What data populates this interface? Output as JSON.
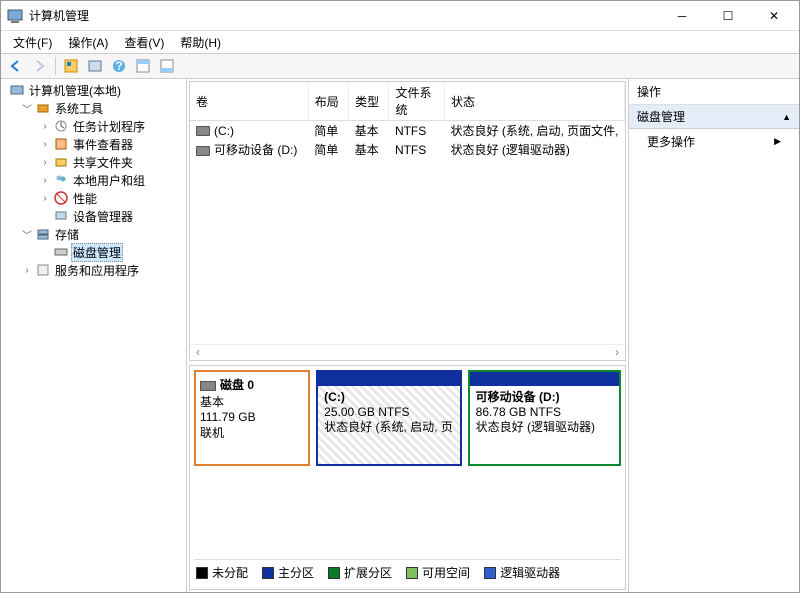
{
  "window": {
    "title": "计算机管理"
  },
  "menu": {
    "file": "文件(F)",
    "action": "操作(A)",
    "view": "查看(V)",
    "help": "帮助(H)"
  },
  "tree": {
    "root": "计算机管理(本地)",
    "systools": "系统工具",
    "scheduler": "任务计划程序",
    "eventviewer": "事件查看器",
    "sharedfolders": "共享文件夹",
    "localusers": "本地用户和组",
    "performance": "性能",
    "devmgr": "设备管理器",
    "storage": "存储",
    "diskmgmt": "磁盘管理",
    "services": "服务和应用程序"
  },
  "volHeaders": {
    "vol": "卷",
    "layout": "布局",
    "type": "类型",
    "fs": "文件系统",
    "status": "状态"
  },
  "volumes": [
    {
      "name": "(C:)",
      "layout": "简单",
      "type": "基本",
      "fs": "NTFS",
      "status": "状态良好 (系统, 启动, 页面文件,"
    },
    {
      "name": "可移动设备 (D:)",
      "layout": "简单",
      "type": "基本",
      "fs": "NTFS",
      "status": "状态良好 (逻辑驱动器)"
    }
  ],
  "disk": {
    "title": "磁盘 0",
    "type": "基本",
    "size": "111.79 GB",
    "state": "联机"
  },
  "partC": {
    "label": "(C:)",
    "size": "25.00 GB NTFS",
    "status": "状态良好 (系统, 启动, 页"
  },
  "partD": {
    "label": "可移动设备  (D:)",
    "size": "86.78 GB NTFS",
    "status": "状态良好 (逻辑驱动器)"
  },
  "legend": {
    "unalloc": "未分配",
    "primary": "主分区",
    "extended": "扩展分区",
    "free": "可用空间",
    "logical": "逻辑驱动器"
  },
  "actions": {
    "header": "操作",
    "section": "磁盘管理",
    "more": "更多操作"
  }
}
